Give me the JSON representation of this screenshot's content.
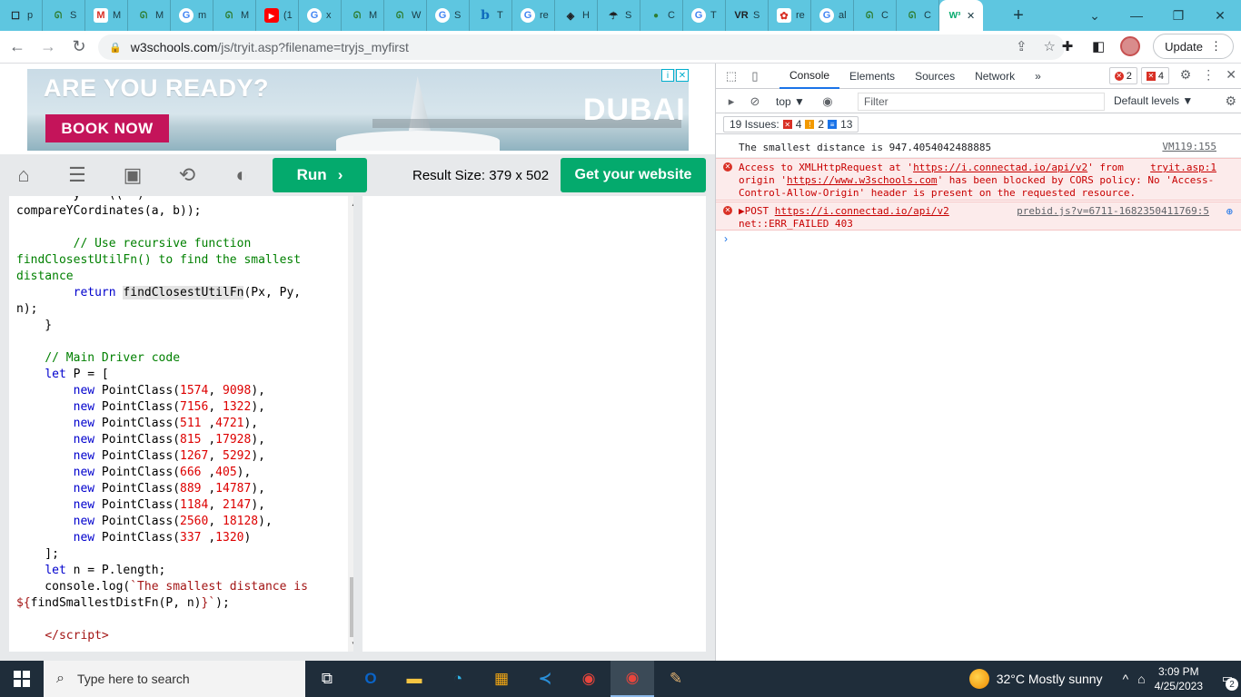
{
  "browser": {
    "tabs": [
      {
        "icon": "page-icon",
        "title": "p",
        "glyph": "☐",
        "cls": ""
      },
      {
        "icon": "geeks-icon",
        "title": "S",
        "glyph": "ᘏ",
        "cls": "green"
      },
      {
        "icon": "gmail-icon",
        "title": "M",
        "glyph": "M",
        "cls": "gmail"
      },
      {
        "icon": "geeks-icon",
        "title": "M",
        "glyph": "ᘏ",
        "cls": "green"
      },
      {
        "icon": "gmail-icon",
        "title": "m",
        "glyph": "G",
        "cls": "google"
      },
      {
        "icon": "geeks-icon",
        "title": "M",
        "glyph": "ᘏ",
        "cls": "green"
      },
      {
        "icon": "youtube-icon",
        "title": "(1",
        "glyph": "▶",
        "cls": "yt"
      },
      {
        "icon": "google-icon",
        "title": "x",
        "glyph": "G",
        "cls": "google"
      },
      {
        "icon": "geeks-icon",
        "title": "M",
        "glyph": "ᘏ",
        "cls": "green"
      },
      {
        "icon": "geeks-icon",
        "title": "W",
        "glyph": "ᘏ",
        "cls": "green"
      },
      {
        "icon": "google-icon",
        "title": "S",
        "glyph": "G",
        "cls": "google"
      },
      {
        "icon": "bing-icon",
        "title": "T",
        "glyph": "b",
        "cls": "bing"
      },
      {
        "icon": "google-icon",
        "title": "re",
        "glyph": "G",
        "cls": "google"
      },
      {
        "icon": "diamond-icon",
        "title": "H",
        "glyph": "◈",
        "cls": ""
      },
      {
        "icon": "jellyfish-icon",
        "title": "S",
        "glyph": "☂",
        "cls": ""
      },
      {
        "icon": "green-dot-icon",
        "title": "C",
        "glyph": "●",
        "cls": "green"
      },
      {
        "icon": "google-icon",
        "title": "T",
        "glyph": "G",
        "cls": "google"
      },
      {
        "icon": "vr-icon",
        "title": "S",
        "glyph": "VR",
        "cls": ""
      },
      {
        "icon": "flower-icon",
        "title": "re",
        "glyph": "✿",
        "cls": "gmail"
      },
      {
        "icon": "google-icon",
        "title": "al",
        "glyph": "G",
        "cls": "google"
      },
      {
        "icon": "geeks-icon",
        "title": "C",
        "glyph": "ᘏ",
        "cls": "green"
      },
      {
        "icon": "geeks-icon",
        "title": "C",
        "glyph": "ᘏ",
        "cls": "green"
      }
    ],
    "active_tab": {
      "glyph": "W³",
      "close": "✕"
    },
    "new_tab": "+",
    "url_host": "w3schools.com",
    "url_path": "/js/tryit.asp?filename=tryjs_myfirst",
    "update_label": "Update"
  },
  "ad": {
    "headline": "ARE YOU READY?",
    "cta": "BOOK NOW",
    "brand": "DUBAI"
  },
  "w3": {
    "run_label": "Run",
    "result_size": "Result Size: 379 x 502",
    "get_website_label": "Get your website"
  },
  "code_lines": [
    {
      "html": "        y    ((  )"
    },
    {
      "html": "compareYCordinates(a, b));"
    },
    {
      "html": ""
    },
    {
      "html": "        <span class='cm'>// Use recursive function</span>"
    },
    {
      "html": "<span class='cm'>findClosestUtilFn() to find the smallest</span>"
    },
    {
      "html": "<span class='cm'>distance</span>"
    },
    {
      "html": "        <span class='kw'>return</span> <span class='hl'>findClosestUtilFn</span>(Px, Py,"
    },
    {
      "html": "n);"
    },
    {
      "html": "    }"
    },
    {
      "html": ""
    },
    {
      "html": "    <span class='cm'>// Main Driver code</span>"
    },
    {
      "html": "    <span class='kw'>let</span> P = ["
    },
    {
      "html": "        <span class='kw'>new</span> PointClass(<span class='num'>1574</span>, <span class='num'>9098</span>),"
    },
    {
      "html": "        <span class='kw'>new</span> PointClass(<span class='num'>7156</span>, <span class='num'>1322</span>),"
    },
    {
      "html": "        <span class='kw'>new</span> PointClass(<span class='num'>511</span> ,<span class='num'>4721</span>),"
    },
    {
      "html": "        <span class='kw'>new</span> PointClass(<span class='num'>815</span> ,<span class='num'>17928</span>),"
    },
    {
      "html": "        <span class='kw'>new</span> PointClass(<span class='num'>1267</span>, <span class='num'>5292</span>),"
    },
    {
      "html": "        <span class='kw'>new</span> PointClass(<span class='num'>666</span> ,<span class='num'>405</span>),"
    },
    {
      "html": "        <span class='kw'>new</span> PointClass(<span class='num'>889</span> ,<span class='num'>14787</span>),"
    },
    {
      "html": "        <span class='kw'>new</span> PointClass(<span class='num'>1184</span>, <span class='num'>2147</span>),"
    },
    {
      "html": "        <span class='kw'>new</span> PointClass(<span class='num'>2560</span>, <span class='num'>18128</span>),"
    },
    {
      "html": "        <span class='kw'>new</span> PointClass(<span class='num'>337</span> ,<span class='num'>1320</span>)"
    },
    {
      "html": "    ];"
    },
    {
      "html": "    <span class='kw'>let</span> n = P.length;"
    },
    {
      "html": "    console.log(<span class='str'>`The smallest distance is</span>"
    },
    {
      "html": "<span class='str'>${</span>findSmallestDistFn(P, n)<span class='str'>}`</span>);"
    },
    {
      "html": ""
    },
    {
      "html": "    <span class='tag'>&lt;/script&gt;</span>"
    }
  ],
  "devtools": {
    "tabs": [
      "Console",
      "Elements",
      "Sources",
      "Network"
    ],
    "more": "»",
    "error_count": "2",
    "warn_count": "4",
    "context": "top ▼",
    "filter_placeholder": "Filter",
    "levels": "Default levels ▼",
    "issues_label": "19 Issues:",
    "issues_red": "4",
    "issues_yellow": "2",
    "issues_blue": "13",
    "log1": "The smallest distance is 947.4054042488885",
    "log1_src": "VM119:155",
    "err1_a": "Access to XMLHttpRequest at '",
    "err1_link1": "https://i.connectad.io/api/v2",
    "err1_b": "' from",
    "err1_c": "origin '",
    "err1_link2": "https://www.w3schools.com",
    "err1_d": "' has been blocked by CORS policy: No 'Access-",
    "err1_e": "Control-Allow-Origin' header is present on the requested resource.",
    "err1_src": "tryit.asp:1",
    "err2_a": "▶POST ",
    "err2_link": "https://i.connectad.io/api/v2",
    "err2_b": "net::ERR_FAILED 403",
    "err2_src": "prebid.js?v=6711-1682350411769:5"
  },
  "taskbar": {
    "search_placeholder": "Type here to search",
    "weather": "32°C  Mostly sunny",
    "time": "3:09 PM",
    "date": "4/25/2023",
    "notif_count": "2"
  }
}
